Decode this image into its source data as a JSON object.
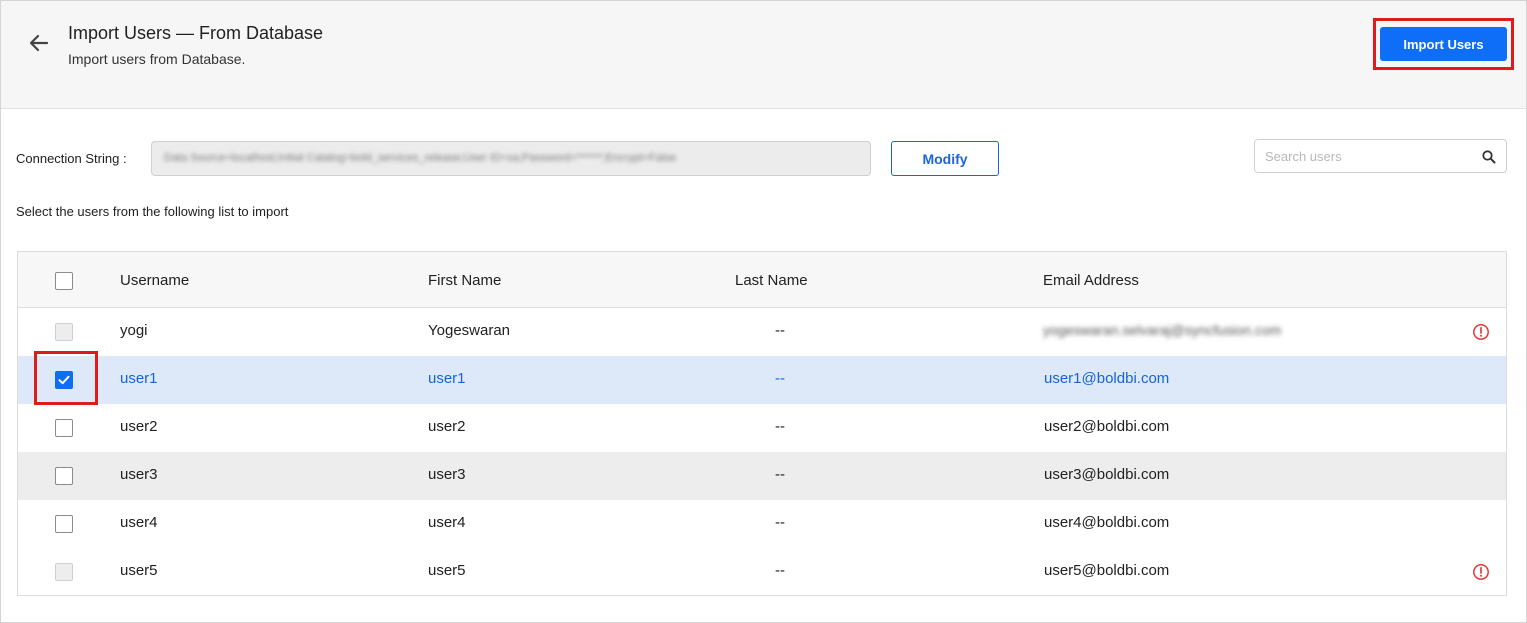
{
  "header": {
    "title": "Import Users — From Database",
    "subtitle": "Import users from Database.",
    "import_button": "Import Users",
    "back_icon": "arrow-left-icon"
  },
  "connection": {
    "label": "Connection String :",
    "value": "Data Source=localhost;Initial Catalog=bold_services_release;User ID=sa;Password=******;Encrypt=False",
    "modify_button": "Modify"
  },
  "search": {
    "placeholder": "Search users",
    "icon": "search-icon"
  },
  "instructions": "Select the users from the following list to import",
  "table": {
    "columns": [
      "Username",
      "First Name",
      "Last Name",
      "Email Address"
    ],
    "rows": [
      {
        "username": "yogi",
        "first_name": "Yogeswaran",
        "last_name": "--",
        "email": "yogeswaran.selvaraj@syncfusion.com",
        "selectable": false,
        "checked": false,
        "warning": true
      },
      {
        "username": "user1",
        "first_name": "user1",
        "last_name": "--",
        "email": "user1@boldbi.com",
        "selectable": true,
        "checked": true,
        "warning": false
      },
      {
        "username": "user2",
        "first_name": "user2",
        "last_name": "--",
        "email": "user2@boldbi.com",
        "selectable": true,
        "checked": false,
        "warning": false
      },
      {
        "username": "user3",
        "first_name": "user3",
        "last_name": "--",
        "email": "user3@boldbi.com",
        "selectable": true,
        "checked": false,
        "warning": false
      },
      {
        "username": "user4",
        "first_name": "user4",
        "last_name": "--",
        "email": "user4@boldbi.com",
        "selectable": true,
        "checked": false,
        "warning": false
      },
      {
        "username": "user5",
        "first_name": "user5",
        "last_name": "--",
        "email": "user5@boldbi.com",
        "selectable": false,
        "checked": false,
        "warning": true
      }
    ]
  },
  "colors": {
    "accent": "#0e6ef8",
    "selected_row": "#dde8f9",
    "highlight_outline": "#e11a1a",
    "warning": "#e53935"
  }
}
